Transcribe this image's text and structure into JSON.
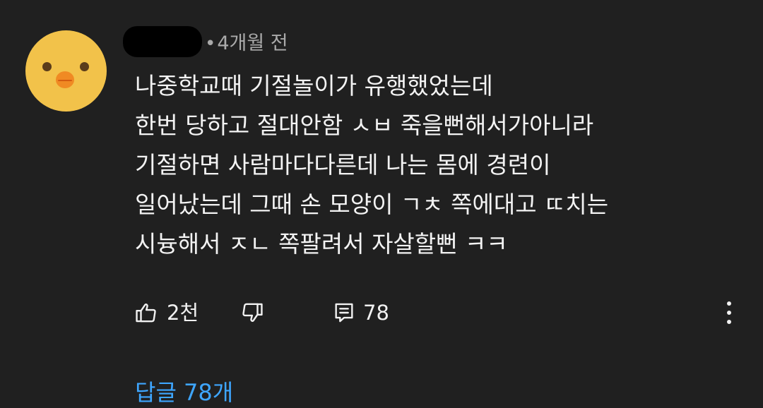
{
  "comment": {
    "timestamp": "4개월 전",
    "lines": [
      "나중학교때 기절놀이가 유행했었는데",
      "한번 당하고 절대안함 ㅅㅂ 죽을뻔해서가아니라",
      "기절하면 사람마다다른데 나는 몸에 경련이",
      "일어났는데 그때 손 모양이 ㄱㅊ 쪽에대고 ㄸ치는",
      "시늉해서 ㅈㄴ 쪽팔려서 자살할뻔 ㅋㅋ"
    ]
  },
  "actions": {
    "like_count": "2천",
    "reply_count": "78"
  },
  "replies": {
    "label": "답글 78개"
  },
  "colors": {
    "background": "#202020",
    "text": "#f1f1f1",
    "meta": "#aaaaaa",
    "link": "#3ea6ff",
    "avatar": "#f2c24a",
    "beak": "#f08a23"
  },
  "icons": {
    "avatar": "chick-avatar",
    "like": "thumbs-up-icon",
    "dislike": "thumbs-down-icon",
    "reply": "comment-icon",
    "more": "more-vertical-icon"
  }
}
